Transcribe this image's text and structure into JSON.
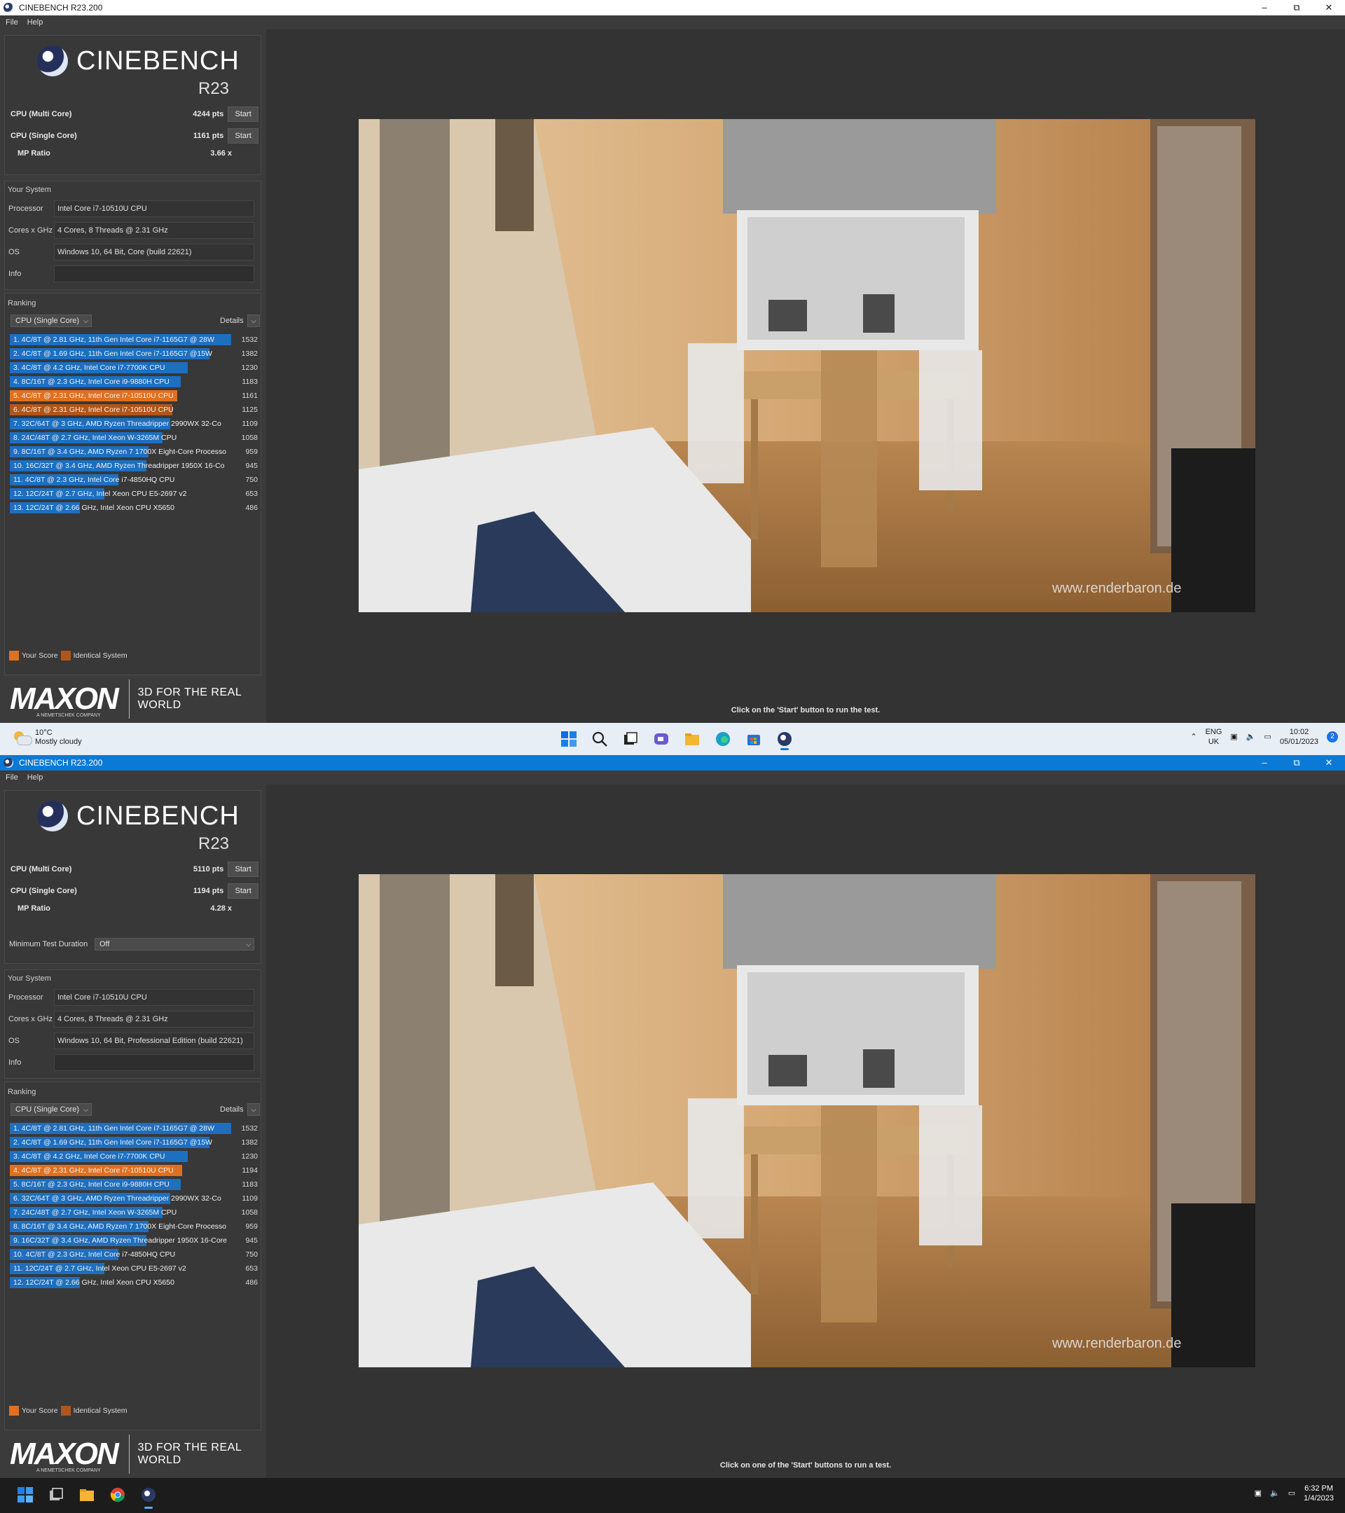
{
  "top_window": {
    "title": "CINEBENCH R23.200",
    "menu": [
      "File",
      "Help"
    ],
    "app_name": "CINEBENCH",
    "version": "R23",
    "scores": {
      "multi_label": "CPU (Multi Core)",
      "multi_value": "4244 pts",
      "single_label": "CPU (Single Core)",
      "single_value": "1161 pts",
      "start": "Start",
      "mp_label": "MP Ratio",
      "mp_value": "3.66 x"
    },
    "your_system": "Your System",
    "system": [
      {
        "key": "Processor",
        "value": "Intel Core i7-10510U CPU"
      },
      {
        "key": "Cores x GHz",
        "value": "4 Cores, 8 Threads @ 2.31 GHz"
      },
      {
        "key": "OS",
        "value": "Windows 10, 64 Bit, Core (build 22621)"
      },
      {
        "key": "Info",
        "value": ""
      }
    ],
    "ranking_label": "Ranking",
    "ranking_mode": "CPU (Single Core)",
    "details": "Details",
    "ranking": [
      {
        "label": "1. 4C/8T @ 2.81 GHz, 11th Gen Intel Core i7-1165G7 @ 28W",
        "score": 1532,
        "kind": "blue"
      },
      {
        "label": "2. 4C/8T @ 1.69 GHz, 11th Gen Intel Core i7-1165G7 @15W",
        "score": 1382,
        "kind": "blue"
      },
      {
        "label": "3. 4C/8T @ 4.2 GHz, Intel Core i7-7700K CPU",
        "score": 1230,
        "kind": "blue"
      },
      {
        "label": "4. 8C/16T @ 2.3 GHz, Intel Core i9-9880H CPU",
        "score": 1183,
        "kind": "blue"
      },
      {
        "label": "5. 4C/8T @ 2.31 GHz, Intel Core i7-10510U CPU",
        "score": 1161,
        "kind": "orange"
      },
      {
        "label": "6. 4C/8T @ 2.31 GHz, Intel Core i7-10510U CPU",
        "score": 1125,
        "kind": "dorange"
      },
      {
        "label": "7. 32C/64T @ 3 GHz, AMD Ryzen Threadripper 2990WX 32-Co",
        "score": 1109,
        "kind": "blue"
      },
      {
        "label": "8. 24C/48T @ 2.7 GHz, Intel Xeon W-3265M CPU",
        "score": 1058,
        "kind": "blue"
      },
      {
        "label": "9. 8C/16T @ 3.4 GHz, AMD Ryzen 7 1700X Eight-Core Processo",
        "score": 959,
        "kind": "blue"
      },
      {
        "label": "10. 16C/32T @ 3.4 GHz, AMD Ryzen Threadripper 1950X 16-Co",
        "score": 945,
        "kind": "blue"
      },
      {
        "label": "11. 4C/8T @ 2.3 GHz, Intel Core i7-4850HQ CPU",
        "score": 750,
        "kind": "blue"
      },
      {
        "label": "12. 12C/24T @ 2.7 GHz, Intel Xeon CPU E5-2697 v2",
        "score": 653,
        "kind": "blue"
      },
      {
        "label": "13. 12C/24T @ 2.66 GHz, Intel Xeon CPU X5650",
        "score": 486,
        "kind": "blue"
      }
    ],
    "legend_your": "Your Score",
    "legend_identical": "Identical System",
    "maxon": "MAXON",
    "maxon_sub": "A NEMETSCHEK COMPANY",
    "tagline": "3D FOR THE REAL WORLD",
    "watermark": "www.renderbaron.de",
    "status": "Click on the 'Start' button to run the test."
  },
  "taskbar1": {
    "temp": "10°C",
    "weather": "Mostly cloudy",
    "lang1": "ENG",
    "lang2": "UK",
    "time": "10:02",
    "date": "05/01/2023",
    "badge": "2"
  },
  "bottom_window": {
    "title": "CINEBENCH R23.200",
    "menu": [
      "File",
      "Help"
    ],
    "app_name": "CINEBENCH",
    "version": "R23",
    "scores": {
      "multi_label": "CPU (Multi Core)",
      "multi_value": "5110 pts",
      "single_label": "CPU (Single Core)",
      "single_value": "1194 pts",
      "start": "Start",
      "mp_label": "MP Ratio",
      "mp_value": "4.28 x"
    },
    "min_duration_label": "Minimum Test Duration",
    "min_duration_value": "Off",
    "your_system": "Your System",
    "system": [
      {
        "key": "Processor",
        "value": "Intel Core i7-10510U CPU"
      },
      {
        "key": "Cores x GHz",
        "value": "4 Cores, 8 Threads @ 2.31 GHz"
      },
      {
        "key": "OS",
        "value": "Windows 10, 64 Bit, Professional Edition (build 22621)"
      },
      {
        "key": "Info",
        "value": ""
      }
    ],
    "ranking_label": "Ranking",
    "ranking_mode": "CPU (Single Core)",
    "details": "Details",
    "ranking": [
      {
        "label": "1. 4C/8T @ 2.81 GHz, 11th Gen Intel Core i7-1165G7 @ 28W",
        "score": 1532,
        "kind": "blue"
      },
      {
        "label": "2. 4C/8T @ 1.69 GHz, 11th Gen Intel Core i7-1165G7 @15W",
        "score": 1382,
        "kind": "blue"
      },
      {
        "label": "3. 4C/8T @ 4.2 GHz, Intel Core i7-7700K CPU",
        "score": 1230,
        "kind": "blue"
      },
      {
        "label": "4. 4C/8T @ 2.31 GHz, Intel Core i7-10510U CPU",
        "score": 1194,
        "kind": "orange"
      },
      {
        "label": "5. 8C/16T @ 2.3 GHz, Intel Core i9-9880H CPU",
        "score": 1183,
        "kind": "blue"
      },
      {
        "label": "6. 32C/64T @ 3 GHz, AMD Ryzen Threadripper 2990WX 32-Co",
        "score": 1109,
        "kind": "blue"
      },
      {
        "label": "7. 24C/48T @ 2.7 GHz, Intel Xeon W-3265M CPU",
        "score": 1058,
        "kind": "blue"
      },
      {
        "label": "8. 8C/16T @ 3.4 GHz, AMD Ryzen 7 1700X Eight-Core Processo",
        "score": 959,
        "kind": "blue"
      },
      {
        "label": "9. 16C/32T @ 3.4 GHz, AMD Ryzen Threadripper 1950X 16-Core",
        "score": 945,
        "kind": "blue"
      },
      {
        "label": "10. 4C/8T @ 2.3 GHz, Intel Core i7-4850HQ CPU",
        "score": 750,
        "kind": "blue"
      },
      {
        "label": "11. 12C/24T @ 2.7 GHz, Intel Xeon CPU E5-2697 v2",
        "score": 653,
        "kind": "blue"
      },
      {
        "label": "12. 12C/24T @ 2.66 GHz, Intel Xeon CPU X5650",
        "score": 486,
        "kind": "blue"
      }
    ],
    "legend_your": "Your Score",
    "legend_identical": "Identical System",
    "maxon": "MAXON",
    "maxon_sub": "A NEMETSCHEK COMPANY",
    "tagline": "3D FOR THE REAL WORLD",
    "watermark": "www.renderbaron.de",
    "status": "Click on one of the 'Start' buttons to run a test."
  },
  "taskbar2": {
    "time": "6:32 PM",
    "date": "1/4/2023"
  },
  "colors": {
    "bar_blue": "#1d6fc0",
    "your_score": "#e0701f",
    "identical_system": "#b0561a",
    "active_title": "#0a7ad6"
  }
}
